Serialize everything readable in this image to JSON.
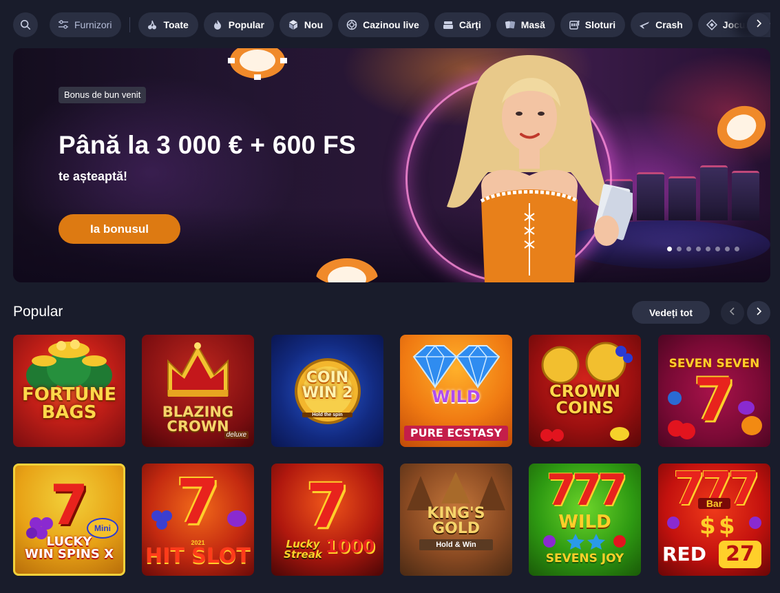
{
  "categories": {
    "providers_label": "Furnizori",
    "items": [
      {
        "label": "Toate",
        "icon": "cherries-icon"
      },
      {
        "label": "Popular",
        "icon": "flame-icon"
      },
      {
        "label": "Nou",
        "icon": "cube-icon"
      },
      {
        "label": "Cazinou live",
        "icon": "chip-icon"
      },
      {
        "label": "Cărți",
        "icon": "cards-stack-icon"
      },
      {
        "label": "Masă",
        "icon": "table-cards-icon"
      },
      {
        "label": "Sloturi",
        "icon": "slot-machine-icon"
      },
      {
        "label": "Crash",
        "icon": "plane-icon"
      },
      {
        "label": "Jocuri Bonus",
        "icon": "diamond-icon"
      }
    ]
  },
  "hero": {
    "tag": "Bonus de bun venit",
    "title": "Până la 3 000 € + 600 FS",
    "subtitle": "te așteaptă!",
    "cta": "Ia bonusul",
    "slides_total": 8,
    "active_slide": 1,
    "accent": "#dd7a12"
  },
  "popular": {
    "title": "Popular",
    "see_all": "Vedeți tot",
    "games": [
      {
        "name_lines": [
          "Fortune",
          "Bags"
        ]
      },
      {
        "name_lines": [
          "Blazing",
          "Crown"
        ],
        "badge": "deluxe"
      },
      {
        "name_lines": [
          "Coin",
          "Win 2"
        ],
        "badge": "Hold the spin"
      },
      {
        "name_lines": [
          "Wild",
          "Pure Ecstasy"
        ]
      },
      {
        "name_lines": [
          "Crown",
          "Coins"
        ]
      },
      {
        "name_lines": [
          "Seven Seven",
          "7"
        ]
      },
      {
        "name_lines": [
          "Lucky",
          "Win Spins X"
        ],
        "badge": "Mini"
      },
      {
        "name_lines": [
          "7",
          "Hit Slot"
        ],
        "badge": "2021"
      },
      {
        "name_lines": [
          "Lucky Streak",
          "1000"
        ]
      },
      {
        "name_lines": [
          "King's",
          "Gold"
        ],
        "badge": "Hold & Win"
      },
      {
        "name_lines": [
          "Wild",
          "Sevens Joy"
        ]
      },
      {
        "name_lines": [
          "Red",
          "27"
        ],
        "badge": "Bar"
      }
    ]
  }
}
